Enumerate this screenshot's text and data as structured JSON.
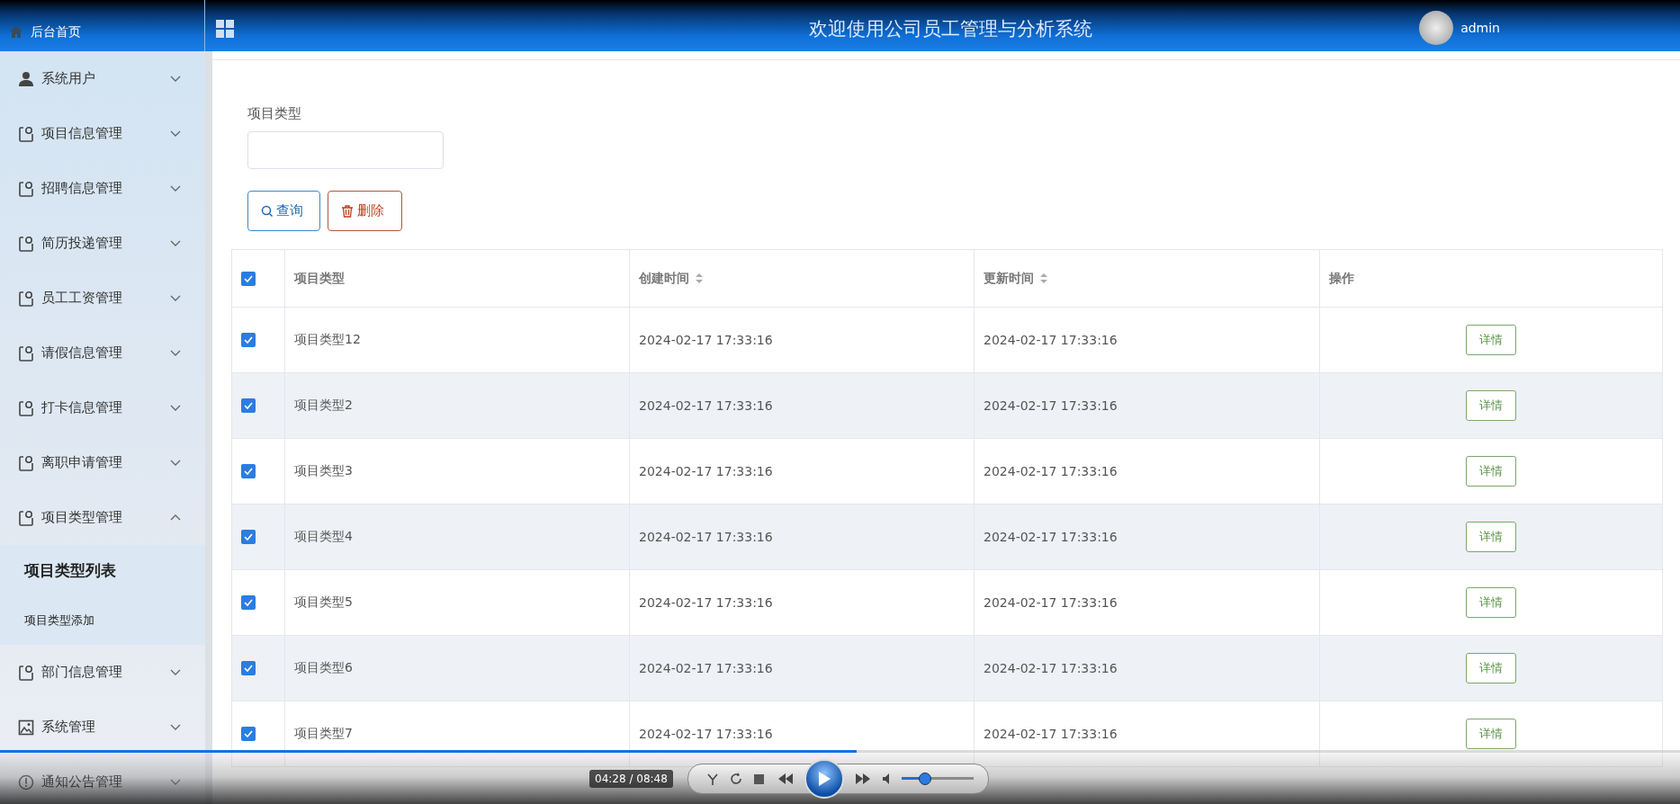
{
  "header": {
    "home": "后台首页",
    "title": "欢迎使用公司员工管理与分析系统",
    "user": "admin"
  },
  "sidebar": {
    "items": [
      {
        "label": "系统用户",
        "kind": "user",
        "expanded": false
      },
      {
        "label": "项目信息管理",
        "kind": "module",
        "expanded": false
      },
      {
        "label": "招聘信息管理",
        "kind": "module",
        "expanded": false
      },
      {
        "label": "简历投递管理",
        "kind": "module",
        "expanded": false
      },
      {
        "label": "员工工资管理",
        "kind": "module",
        "expanded": false
      },
      {
        "label": "请假信息管理",
        "kind": "module",
        "expanded": false
      },
      {
        "label": "打卡信息管理",
        "kind": "module",
        "expanded": false
      },
      {
        "label": "离职申请管理",
        "kind": "module",
        "expanded": false
      },
      {
        "label": "项目类型管理",
        "kind": "module",
        "expanded": true,
        "children": [
          {
            "label": "项目类型列表",
            "selected": true
          },
          {
            "label": "项目类型添加",
            "selected": false
          }
        ]
      },
      {
        "label": "部门信息管理",
        "kind": "module",
        "expanded": false
      },
      {
        "label": "系统管理",
        "kind": "system",
        "expanded": false
      },
      {
        "label": "通知公告管理",
        "kind": "notice",
        "expanded": false
      }
    ]
  },
  "search": {
    "label": "项目类型"
  },
  "buttons": [
    {
      "label": "查询",
      "kind": "search"
    },
    {
      "label": "删除",
      "kind": "delete"
    }
  ],
  "table": {
    "all_checked": true,
    "columns": [
      {
        "label": "项目类型",
        "sortable": false
      },
      {
        "label": "创建时间",
        "sortable": true
      },
      {
        "label": "更新时间",
        "sortable": true
      },
      {
        "label": "操作",
        "sortable": false
      }
    ],
    "rows": [
      {
        "checked": true,
        "cells": [
          "项目类型12",
          "2024-02-17 17:33:16",
          "2024-02-17 17:33:16"
        ],
        "action": "详情"
      },
      {
        "checked": true,
        "cells": [
          "项目类型2",
          "2024-02-17 17:33:16",
          "2024-02-17 17:33:16"
        ],
        "action": "详情"
      },
      {
        "checked": true,
        "cells": [
          "项目类型3",
          "2024-02-17 17:33:16",
          "2024-02-17 17:33:16"
        ],
        "action": "详情"
      },
      {
        "checked": true,
        "cells": [
          "项目类型4",
          "2024-02-17 17:33:16",
          "2024-02-17 17:33:16"
        ],
        "action": "详情"
      },
      {
        "checked": true,
        "cells": [
          "项目类型5",
          "2024-02-17 17:33:16",
          "2024-02-17 17:33:16"
        ],
        "action": "详情"
      },
      {
        "checked": true,
        "cells": [
          "项目类型6",
          "2024-02-17 17:33:16",
          "2024-02-17 17:33:16"
        ],
        "action": "详情"
      },
      {
        "checked": true,
        "cells": [
          "项目类型7",
          "2024-02-17 17:33:16",
          "2024-02-17 17:33:16"
        ],
        "action": "详情"
      }
    ]
  },
  "player": {
    "time": "04:28 / 08:48",
    "progress": {
      "level": 0.51
    },
    "volume": {
      "level": 0.32
    }
  }
}
